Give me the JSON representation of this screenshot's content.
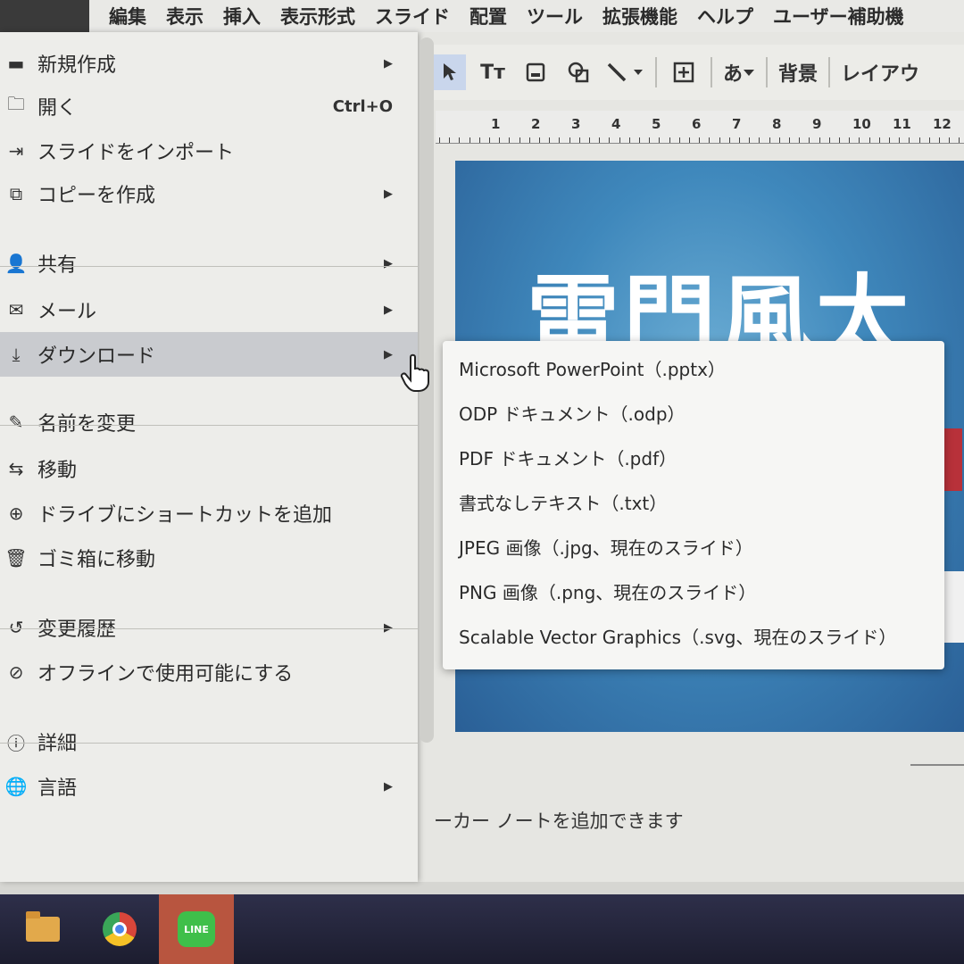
{
  "menubar": {
    "items": [
      "編集",
      "表示",
      "挿入",
      "表示形式",
      "スライド",
      "配置",
      "ツール",
      "拡張機能",
      "ヘルプ",
      "ユーザー補助機"
    ]
  },
  "toolbar": {
    "text_tool": "Tт",
    "japanese_input": "あ",
    "background": "背景",
    "layout": "レイアウ"
  },
  "ruler": {
    "numbers": [
      "1",
      "2",
      "3",
      "4",
      "5",
      "6",
      "7",
      "8",
      "9",
      "10",
      "11",
      "12"
    ]
  },
  "slide": {
    "title": "雷門風太"
  },
  "notes": {
    "placeholder": "ーカー ノートを追加できます"
  },
  "file_menu": {
    "items": [
      {
        "label": "新規作成",
        "icon": "slides-icon",
        "has_submenu": true
      },
      {
        "label": "開く",
        "icon": "folder-icon",
        "shortcut": "Ctrl+O"
      },
      {
        "label": "スライドをインポート",
        "icon": "import-icon"
      },
      {
        "label": "コピーを作成",
        "icon": "copy-icon",
        "has_submenu": true
      },
      {
        "label": "共有",
        "icon": "person-add-icon",
        "has_submenu": true
      },
      {
        "label": "メール",
        "icon": "mail-icon",
        "has_submenu": true
      },
      {
        "label": "ダウンロード",
        "icon": "download-icon",
        "has_submenu": true,
        "highlighted": true
      },
      {
        "label": "名前を変更",
        "icon": "rename-icon"
      },
      {
        "label": "移動",
        "icon": "move-icon"
      },
      {
        "label": "ドライブにショートカットを追加",
        "icon": "drive-shortcut-icon"
      },
      {
        "label": "ゴミ箱に移動",
        "icon": "trash-icon"
      },
      {
        "label": "変更履歴",
        "icon": "history-icon",
        "has_submenu": true
      },
      {
        "label": "オフラインで使用可能にする",
        "icon": "offline-icon"
      },
      {
        "label": "詳細",
        "icon": "info-icon"
      },
      {
        "label": "言語",
        "icon": "globe-icon",
        "has_submenu": true
      }
    ]
  },
  "download_submenu": {
    "items": [
      "Microsoft PowerPoint（.pptx）",
      "ODP ドキュメント（.odp）",
      "PDF ドキュメント（.pdf）",
      "書式なしテキスト（.txt）",
      "JPEG 画像（.jpg、現在のスライド）",
      "PNG 画像（.png、現在のスライド）",
      "Scalable Vector Graphics（.svg、現在のスライド）"
    ]
  },
  "taskbar": {
    "line_app_label": "LINE"
  },
  "colors": {
    "slide_bg": "#3f88bc",
    "menu_bg": "#ededea",
    "highlight": "#c9cbcf",
    "taskbar": "#25263b",
    "line_green": "#3fbf4a"
  }
}
